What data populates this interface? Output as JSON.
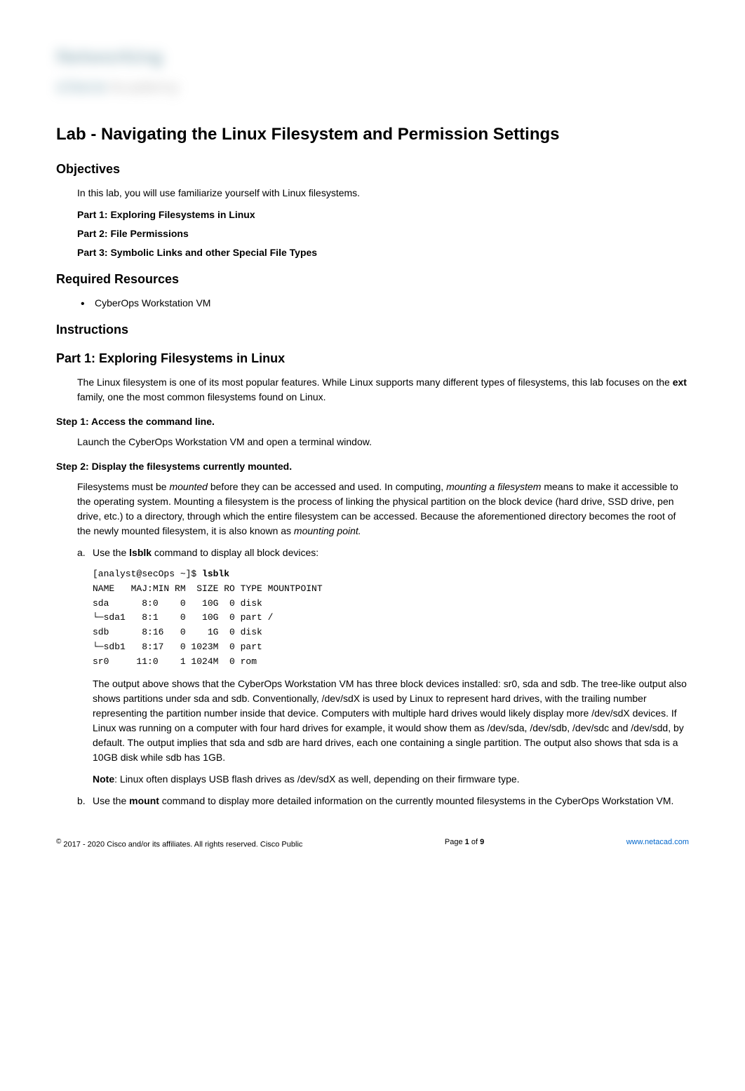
{
  "logo": {
    "line1": "Networking",
    "line2_a": "cisco",
    "line2_b": "Academy"
  },
  "title": "Lab - Navigating the Linux Filesystem and Permission Settings",
  "objectives": {
    "heading": "Objectives",
    "intro": "In this lab, you will use familiarize yourself with Linux filesystems.",
    "parts": [
      "Part 1: Exploring Filesystems in Linux",
      "Part 2: File Permissions",
      "Part 3: Symbolic Links and other Special File Types"
    ]
  },
  "required": {
    "heading": "Required Resources",
    "item": "CyberOps Workstation VM"
  },
  "instructions": {
    "heading": "Instructions"
  },
  "part1": {
    "heading": "Part 1: Exploring Filesystems in Linux",
    "intro_pre": "The Linux filesystem is one of its most popular features. While Linux supports many different types of filesystems, this lab focuses on the ",
    "intro_bold": "ext",
    "intro_post": " family, one the most common filesystems found on Linux."
  },
  "step1": {
    "heading": "Step 1: Access the command line.",
    "text": "Launch the CyberOps Workstation VM and open a terminal window."
  },
  "step2": {
    "heading": "Step 2: Display the filesystems currently mounted.",
    "intro_1": "Filesystems must be ",
    "intro_italic1": "mounted",
    "intro_2": " before they can be accessed and used. In computing, ",
    "intro_italic2": "mounting a filesystem",
    "intro_3": " means to make it accessible to the operating system. Mounting a filesystem is the process of linking the physical partition on the block device (hard drive, SSD drive, pen drive, etc.) to a directory, through which the entire filesystem can be accessed. Because the aforementioned directory becomes the root of the newly mounted filesystem, it is also known as ",
    "intro_italic3": "mounting point.",
    "a_label": "a.",
    "a_text_pre": "Use the ",
    "a_text_bold": "lsblk",
    "a_text_post": " command to display all block devices:",
    "code": {
      "prompt": "[analyst@secOps ~]$ ",
      "cmd": "lsblk",
      "line1": "NAME   MAJ:MIN RM  SIZE RO TYPE MOUNTPOINT",
      "line2": "sda      8:0    0   10G  0 disk",
      "line3": "└─sda1   8:1    0   10G  0 part /",
      "line4": "sdb      8:16   0    1G  0 disk",
      "line5": "└─sdb1   8:17   0 1023M  0 part",
      "line6": "sr0     11:0    1 1024M  0 rom"
    },
    "explain": "The output above shows that the CyberOps Workstation VM has three block devices installed: sr0, sda and sdb. The tree-like output also shows partitions under sda and sdb. Conventionally, /dev/sdX is used by Linux to represent hard drives, with the trailing number representing the partition number inside that device. Computers with multiple hard drives would likely display more /dev/sdX devices. If Linux was running on a computer with four hard drives for example, it would show them as /dev/sda, /dev/sdb, /dev/sdc and /dev/sdd, by default. The output implies that sda and sdb are hard drives, each one containing a single partition. The output also shows that sda is a 10GB disk while sdb has 1GB.",
    "note_bold": "Note",
    "note_text": ": Linux often displays USB flash drives as /dev/sdX as well, depending on their firmware type.",
    "b_label": "b.",
    "b_text_pre": "Use the ",
    "b_text_bold": "mount",
    "b_text_post": " command to display more detailed information on the currently mounted filesystems in the CyberOps Workstation VM."
  },
  "footer": {
    "copyright_symbol": "©",
    "left": " 2017 - 2020 Cisco and/or its affiliates. All rights reserved. Cisco Public",
    "center_pre": "Page ",
    "center_bold1": "1",
    "center_mid": " of ",
    "center_bold2": "9",
    "right": "www.netacad.com"
  }
}
